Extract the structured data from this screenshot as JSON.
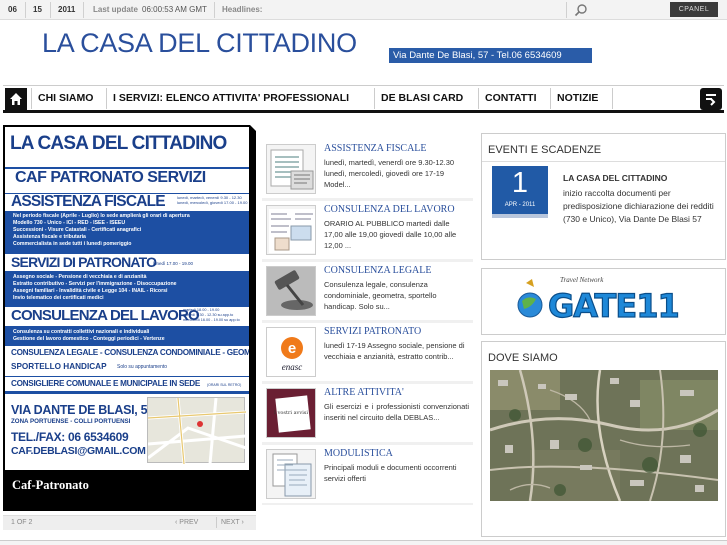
{
  "topbar": {
    "day": "06",
    "month": "15",
    "year": "2011",
    "last_update_label": "Last update",
    "last_update_value": "06:00:53 AM GMT",
    "headlines_label": "Headlines:",
    "cpanel": "CPANEL",
    "search_icon": "search-icon"
  },
  "header": {
    "site_title": "LA CASA DEL CITTADINO",
    "address": "Via Dante De Blasi, 57  -  Tel.06 6534609"
  },
  "nav": {
    "home_icon": "home-icon",
    "items": [
      {
        "label": "CHI SIAMO"
      },
      {
        "label": "I SERVIZI: ELENCO ATTIVITA' PROFESSIONALI"
      },
      {
        "label": "DE BLASI CARD"
      },
      {
        "label": "CONTATTI"
      },
      {
        "label": "NOTIZIE"
      }
    ],
    "menu_icon": "toggle-menu-icon"
  },
  "slider": {
    "caption": "Caf-Patronato",
    "page_label": "1 OF 2",
    "prev_label": "‹ PREV",
    "next_label": "NEXT ›",
    "flyer": {
      "title": "LA CASA DEL CITTADINO",
      "subtitle": "CAF PATRONATO SERVIZI",
      "s1_head": "ASSISTENZA FISCALE",
      "s1_hours": "lunedì, martedì, venerdì 9.30 - 12.30\nlunedì, mercoledì, giovedì 17.00 - 19.00",
      "s1_lines": [
        "Nel periodo fiscale (Aprile - Luglio) lo sede amplierà gli orari di apertura",
        "Modello 730 - Unico - ICI - RED - ISEE - ISEEU",
        "Successioni - Visure Catastali - Certificati anagrafici",
        "Assistenza fiscale e tributaria",
        "Commercialista in sede tutti i lunedì pomeriggio"
      ],
      "s2_head": "SERVIZI DI PATRONATO",
      "s2_hours": "lunedì 17.00 - 19.00",
      "s2_lines": [
        "Assegno sociale - Pensione di vecchiaia e di anzianità",
        "Estratto contributivo - Servizi per l'immigrazione - Disoccupazione",
        "Assegni familiari - Invalidità civile e Legge 104 - INAIL - Ricorsi",
        "Invio telematico dei certificati medici"
      ],
      "s3_head": "CONSULENZA DEL LAVORO",
      "s3_hours": "martedì 18.00 - 19.00\ngiovedì 9.30 - 12.30 su app.to\nmercoledì 16.00 - 19.00 su app.to",
      "s3_lines": [
        "Consulenza su contratti collettivi nazionali e individuali",
        "Gestione del lavoro domestico - Conteggi periodici - Vertenze"
      ],
      "s4": "CONSULENZA LEGALE - CONSULENZA CONDOMINIALE - GEOMETRA",
      "s5": "SPORTELLO HANDICAP",
      "s5_note": "Solo su appuntamento",
      "s6": "CONSIGLIERE COMUNALE E MUNICIPALE IN SEDE",
      "s6_note": "(ORARI SUL RETRO)",
      "addr1": "VIA DANTE DE BLASI, 57",
      "addr2": "ZONA PORTUENSE - COLLI PORTUENSI",
      "tel": "TEL./FAX: 06 6534609",
      "email": "CAF.DEBLASI@GMAIL.COM"
    }
  },
  "slides_list": [
    {
      "title": "ASSISTENZA FISCALE",
      "text": "lunedì, martedì, venerdì ore 9.30-12.30 lunedì, mercoledì, giovedì ore 17-19 Model..."
    },
    {
      "title": "CONSULENZA DEL LAVORO",
      "text": "ORARIO AL PUBBLICO martedì dalle 17,00 alle 19,00 giovedì dalle 10,00 alle 12,00 ..."
    },
    {
      "title": "CONSULENZA LEGALE",
      "text": "Consulenza legale, consulenza condominiale, geometra, sportello handicap. Solo su..."
    },
    {
      "title": "SERVIZI PATRONATO",
      "text": "lunedì 17-19 Assegno sociale, pensione di vecchiaia e anzianità, estratto contrib..."
    },
    {
      "title": "ALTRE ATTIVITA'",
      "text": "Gli esercizi e i professionisti convenzionati inseriti nel circuito della DEBLAS..."
    },
    {
      "title": "MODULISTICA",
      "text": "Principali moduli e documenti occorrenti servizi offerti"
    }
  ],
  "thumb_texts": {
    "enasc": "enasc",
    "note": "I vostri avvisi"
  },
  "events": {
    "heading": "EVENTI E SCADENZE",
    "day": "1",
    "month": "APR - 2011",
    "title": "LA CASA DEL CITTADINO",
    "text": "inizio raccolta documenti per predisposizione dichiarazione dei redditi (730 e Unico), Via Dante De Blasi 57"
  },
  "banner": {
    "tagline": "Travel Network",
    "name": "GATE 11"
  },
  "map_box": {
    "heading": "DOVE SIAMO"
  },
  "colors": {
    "brand_blue": "#2a4f9c",
    "nav_border": "#111111",
    "flyer_blue": "#1d4fa3"
  }
}
